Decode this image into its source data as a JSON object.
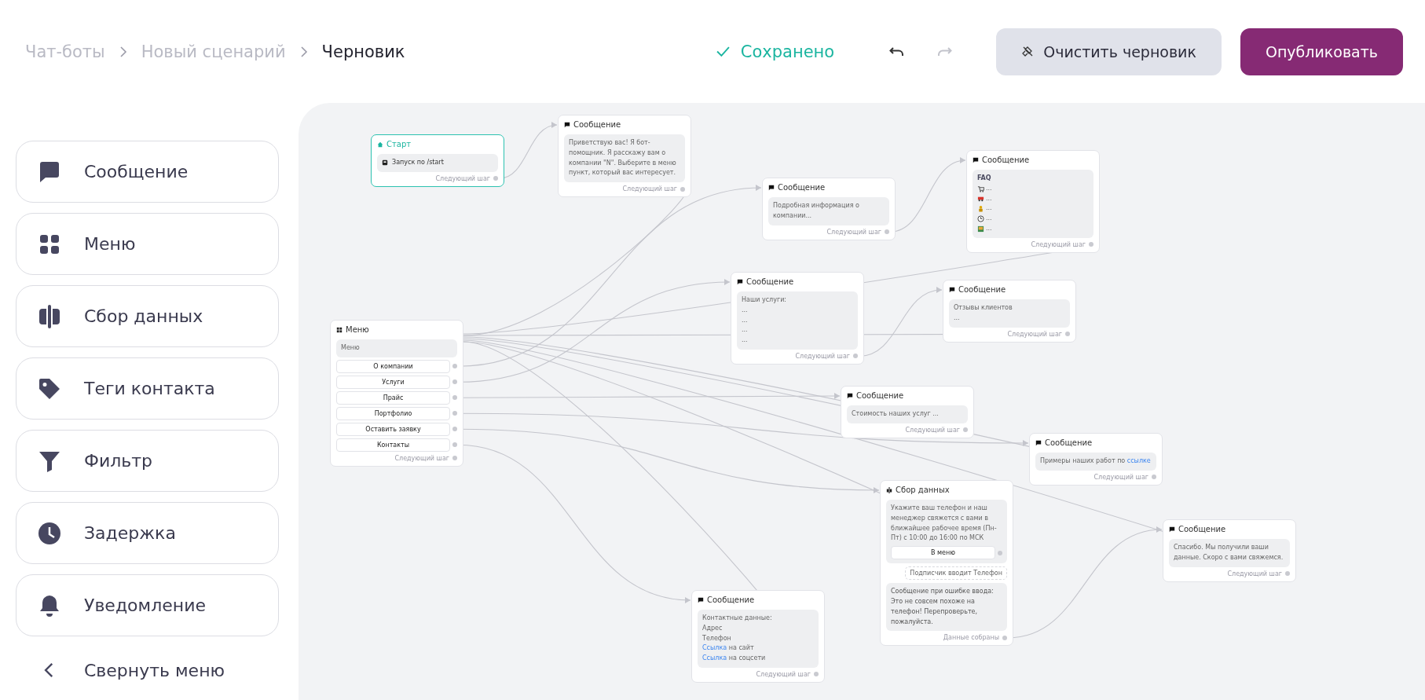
{
  "breadcrumbs": [
    {
      "label": "Чат-боты",
      "current": false
    },
    {
      "label": "Новый сценарий",
      "current": false
    },
    {
      "label": "Черновик",
      "current": true
    }
  ],
  "save_status": "Сохранено",
  "history": {
    "undo_disabled": false,
    "redo_disabled": true
  },
  "buttons": [
    {
      "label": "Очистить черновик",
      "kind": "secondary"
    },
    {
      "label": "Опубликовать",
      "kind": "primary"
    }
  ],
  "sidebar": {
    "items": [
      {
        "label": "Сообщение",
        "kind": "message"
      },
      {
        "label": "Меню",
        "kind": "menu"
      },
      {
        "label": "Сбор данных",
        "kind": "data"
      },
      {
        "label": "Теги контакта",
        "kind": "tags"
      },
      {
        "label": "Фильтр",
        "kind": "filter"
      },
      {
        "label": "Задержка",
        "kind": "delay"
      },
      {
        "label": "Уведомление",
        "kind": "notification"
      }
    ],
    "collapse_label": "Свернуть меню"
  },
  "nodes": [
    {
      "kind": "start",
      "title": "Старт",
      "trigger": "Запуск по /start",
      "footer": "Следующий шаг"
    },
    {
      "kind": "message",
      "title": "Сообщение",
      "lines": [
        {
          "kind": "text",
          "segments": [
            {
              "text": "Приветствую вас! Я бот-помощник. Я расскажу вам о компании \"N\". Выберите в меню пункт, который вас интересует.",
              "link": false
            }
          ]
        }
      ],
      "footer": "Следующий шаг"
    },
    {
      "kind": "menu",
      "title": "Меню",
      "text": "Меню",
      "buttons": [
        "О компании",
        "Услуги",
        "Прайс",
        "Портфолио",
        "Оставить заявку",
        "Контакты"
      ],
      "footer": "Следующий шаг"
    },
    {
      "kind": "message",
      "title": "Сообщение",
      "lines": [
        {
          "kind": "text",
          "segments": [
            {
              "text": "Подробная информация о компании...",
              "link": false
            }
          ]
        }
      ],
      "footer": "Следующий шаг"
    },
    {
      "kind": "message",
      "title": "Сообщение",
      "lines": [
        {
          "kind": "heading",
          "segments": [
            {
              "text": "FAQ",
              "link": false
            }
          ]
        },
        {
          "kind": "emoji",
          "segments": [
            {
              "text": "...",
              "link": false
            }
          ]
        },
        {
          "kind": "emoji",
          "segments": [
            {
              "text": "...",
              "link": false
            }
          ]
        },
        {
          "kind": "emoji",
          "segments": [
            {
              "text": "...",
              "link": false
            }
          ]
        },
        {
          "kind": "emoji",
          "segments": [
            {
              "text": "...",
              "link": false
            }
          ]
        },
        {
          "kind": "emoji",
          "segments": [
            {
              "text": "...",
              "link": false
            }
          ]
        }
      ],
      "footer": "Следующий шаг"
    },
    {
      "kind": "message",
      "title": "Сообщение",
      "lines": [
        {
          "kind": "text",
          "segments": [
            {
              "text": "Наши услуги:",
              "link": false
            }
          ]
        },
        {
          "kind": "text",
          "segments": [
            {
              "text": "...",
              "link": false
            }
          ]
        },
        {
          "kind": "text",
          "segments": [
            {
              "text": "...",
              "link": false
            }
          ]
        },
        {
          "kind": "text",
          "segments": [
            {
              "text": "...",
              "link": false
            }
          ]
        },
        {
          "kind": "text",
          "segments": [
            {
              "text": "...",
              "link": false
            }
          ]
        }
      ],
      "footer": "Следующий шаг"
    },
    {
      "kind": "message",
      "title": "Сообщение",
      "lines": [
        {
          "kind": "text",
          "segments": [
            {
              "text": "Отзывы клиентов",
              "link": false
            }
          ]
        },
        {
          "kind": "text",
          "segments": [
            {
              "text": "...",
              "link": false
            }
          ]
        }
      ],
      "footer": "Следующий шаг"
    },
    {
      "kind": "message",
      "title": "Сообщение",
      "lines": [
        {
          "kind": "text",
          "segments": [
            {
              "text": "Стоимость наших услуг ...",
              "link": false
            }
          ]
        }
      ],
      "footer": "Следующий шаг"
    },
    {
      "kind": "message",
      "title": "Сообщение",
      "lines": [
        {
          "kind": "text",
          "segments": [
            {
              "text": "Примеры наших работ по ",
              "link": false
            },
            {
              "text": "ссылке",
              "link": true
            }
          ]
        }
      ],
      "footer": "Следующий шаг"
    },
    {
      "kind": "data",
      "title": "Сбор данных",
      "text": "Укажите ваш телефон и наш менеджер свяжется с вами в ближайшее рабочее время (Пн-Пт) с 10:00 до 16:00 по МСК",
      "button": "В меню",
      "input_label": "Подписчик вводит Телефон",
      "error_text": "Сообщение при ошибке ввода: Это не совсем похоже на телефон! Перепроверьте, пожалуйста.",
      "footer": "Данные собраны"
    },
    {
      "kind": "message",
      "title": "Сообщение",
      "lines": [
        {
          "kind": "text",
          "segments": [
            {
              "text": "Спасибо. Мы получили ваши данные. Скоро с вами свяжемся.",
              "link": false
            }
          ]
        }
      ],
      "footer": "Следующий шаг"
    },
    {
      "kind": "message",
      "title": "Сообщение",
      "lines": [
        {
          "kind": "text",
          "segments": [
            {
              "text": "Контактные данные:",
              "link": false
            }
          ]
        },
        {
          "kind": "text",
          "segments": [
            {
              "text": "Адрес",
              "link": false
            }
          ]
        },
        {
          "kind": "text",
          "segments": [
            {
              "text": "Телефон",
              "link": false
            }
          ]
        },
        {
          "kind": "text",
          "segments": [
            {
              "text": "Ссылка",
              "link": true
            },
            {
              "text": " на сайт",
              "link": false
            }
          ]
        },
        {
          "kind": "text",
          "segments": [
            {
              "text": "Ссылка",
              "link": true
            },
            {
              "text": " на соцсети",
              "link": false
            }
          ]
        }
      ],
      "footer": "Следующий шаг"
    }
  ]
}
